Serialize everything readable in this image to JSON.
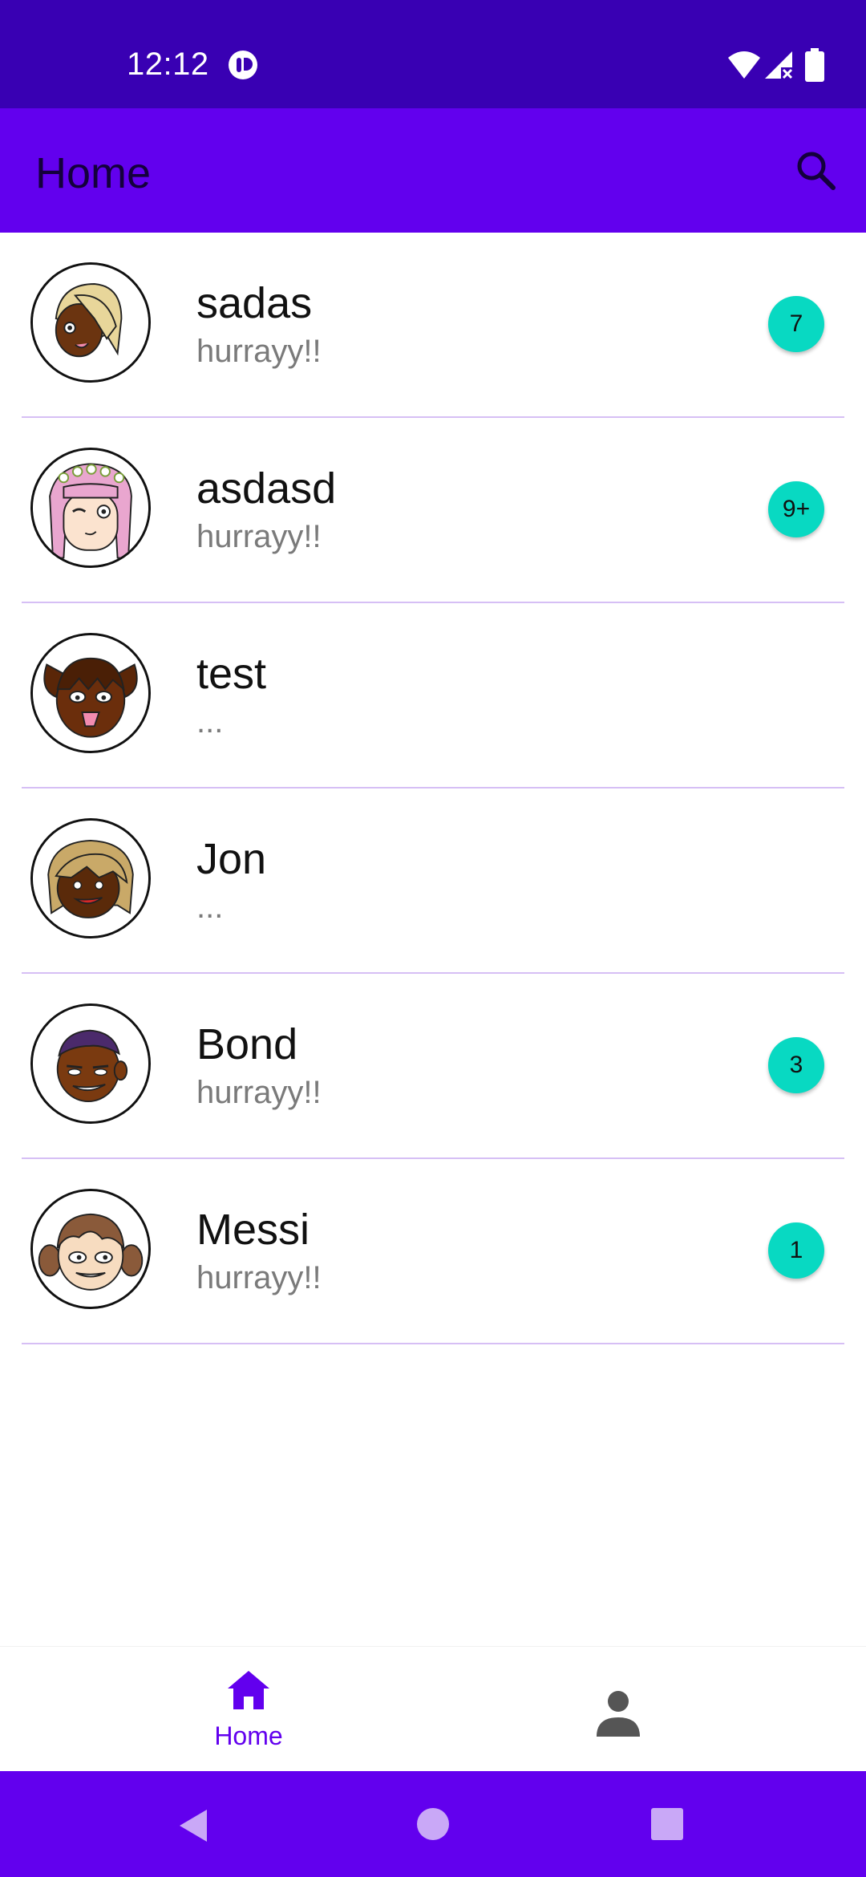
{
  "status_bar": {
    "time": "12:12"
  },
  "app_bar": {
    "title": "Home"
  },
  "chats": [
    {
      "name": "sadas",
      "preview": "hurrayy!!",
      "unread": "7"
    },
    {
      "name": "asdasd",
      "preview": "hurrayy!!",
      "unread": "9+"
    },
    {
      "name": "test",
      "preview": "...",
      "unread": ""
    },
    {
      "name": "Jon",
      "preview": "...",
      "unread": ""
    },
    {
      "name": "Bond",
      "preview": "hurrayy!!",
      "unread": "3"
    },
    {
      "name": "Messi",
      "preview": "hurrayy!!",
      "unread": "1"
    }
  ],
  "bottom_nav": {
    "home_label": "Home"
  },
  "colors": {
    "status_bar": "#3900b3",
    "app_bar": "#6200ee",
    "accent": "#6200ee",
    "badge": "#08d9c2",
    "divider": "#d6bff5"
  }
}
